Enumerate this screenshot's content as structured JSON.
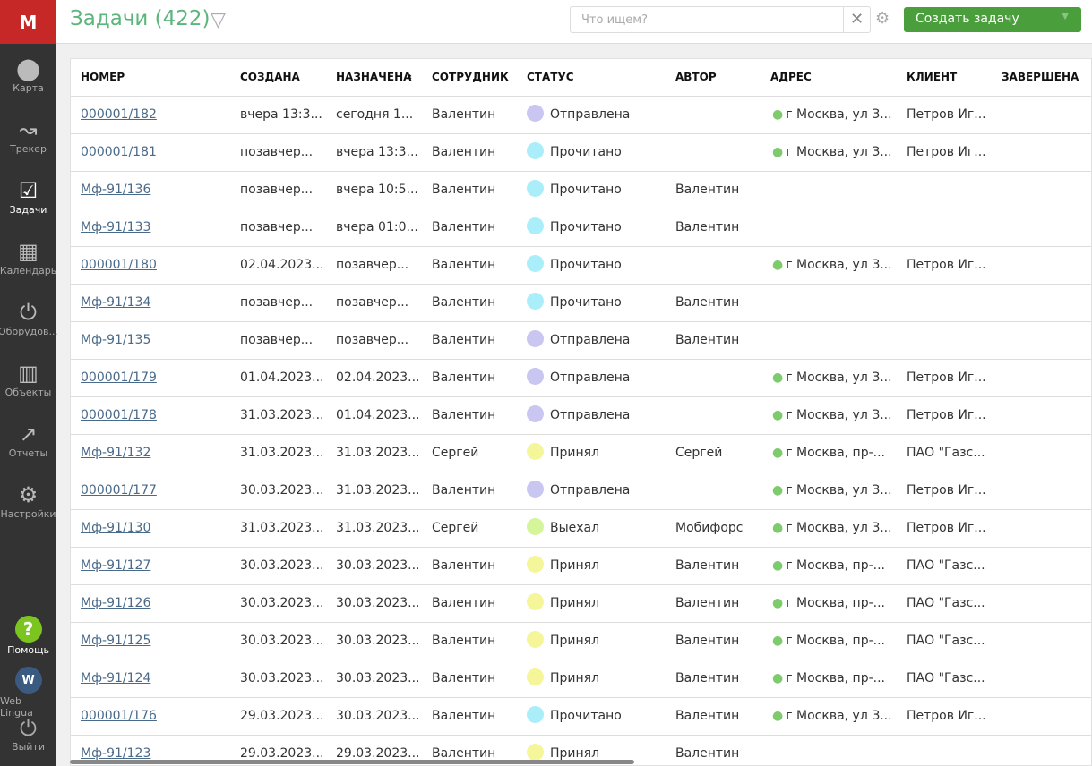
{
  "app": {
    "logo": "M",
    "title": "Задачи (422)"
  },
  "sidebar": {
    "items": [
      {
        "label": "Карта",
        "icon": "map-pin-icon",
        "glyph": "⬤"
      },
      {
        "label": "Трекер",
        "icon": "route-icon",
        "glyph": "↝"
      },
      {
        "label": "Задачи",
        "icon": "clipboard-check-icon",
        "glyph": "☑",
        "active": true
      },
      {
        "label": "Календарь",
        "icon": "calendar-icon",
        "glyph": "▦"
      },
      {
        "label": "Оборудов...",
        "icon": "plug-icon",
        "glyph": "⏻"
      },
      {
        "label": "Объекты",
        "icon": "building-icon",
        "glyph": "▥"
      },
      {
        "label": "Отчеты",
        "icon": "chart-icon",
        "glyph": "↗"
      },
      {
        "label": "Настройки",
        "icon": "gear-icon",
        "glyph": "⚙"
      }
    ],
    "help": "Помощь",
    "lang_label": "Web Lingua",
    "lang_glyph": "W",
    "logout": "Выйти"
  },
  "search": {
    "placeholder": "Что ищем?"
  },
  "create_button": "Создать задачу",
  "columns": [
    "НОМЕР",
    "СОЗДАНА",
    "НАЗНАЧЕНА",
    "СОТРУДНИК",
    "СТАТУС",
    "АВТОР",
    "АДРЕС",
    "КЛИЕНТ",
    "ЗАВЕРШЕНА"
  ],
  "status_colors": {
    "Отправлена": "#c9c6f2",
    "Прочитано": "#aaeefa",
    "Принял": "#f5f59a",
    "Выехал": "#d4f59a"
  },
  "rows": [
    [
      "000001/182",
      "вчера 13:3...",
      "сегодня 1...",
      "Валентин",
      "Отправлена",
      "",
      "г Москва, ул З...",
      "Петров Иг...",
      ""
    ],
    [
      "000001/181",
      "позавчер...",
      "вчера 13:3...",
      "Валентин",
      "Прочитано",
      "",
      "г Москва, ул З...",
      "Петров Иг...",
      ""
    ],
    [
      "Мф-91/136",
      "позавчер...",
      "вчера 10:5...",
      "Валентин",
      "Прочитано",
      "Валентин",
      "",
      "",
      ""
    ],
    [
      "Мф-91/133",
      "позавчер...",
      "вчера 01:0...",
      "Валентин",
      "Прочитано",
      "Валентин",
      "",
      "",
      ""
    ],
    [
      "000001/180",
      "02.04.2023...",
      "позавчер...",
      "Валентин",
      "Прочитано",
      "",
      "г Москва, ул З...",
      "Петров Иг...",
      ""
    ],
    [
      "Мф-91/134",
      "позавчер...",
      "позавчер...",
      "Валентин",
      "Прочитано",
      "Валентин",
      "",
      "",
      ""
    ],
    [
      "Мф-91/135",
      "позавчер...",
      "позавчер...",
      "Валентин",
      "Отправлена",
      "Валентин",
      "",
      "",
      ""
    ],
    [
      "000001/179",
      "01.04.2023...",
      "02.04.2023...",
      "Валентин",
      "Отправлена",
      "",
      "г Москва, ул З...",
      "Петров Иг...",
      ""
    ],
    [
      "000001/178",
      "31.03.2023...",
      "01.04.2023...",
      "Валентин",
      "Отправлена",
      "",
      "г Москва, ул З...",
      "Петров Иг...",
      ""
    ],
    [
      "Мф-91/132",
      "31.03.2023...",
      "31.03.2023...",
      "Сергей",
      "Принял",
      "Сергей",
      "г Москва, пр-...",
      "ПАО \"Газс...",
      ""
    ],
    [
      "000001/177",
      "30.03.2023...",
      "31.03.2023...",
      "Валентин",
      "Отправлена",
      "",
      "г Москва, ул З...",
      "Петров Иг...",
      ""
    ],
    [
      "Мф-91/130",
      "31.03.2023...",
      "31.03.2023...",
      "Сергей",
      "Выехал",
      "Мобифорс",
      "г Москва, ул З...",
      "Петров Иг...",
      ""
    ],
    [
      "Мф-91/127",
      "30.03.2023...",
      "30.03.2023...",
      "Валентин",
      "Принял",
      "Валентин",
      "г Москва, пр-...",
      "ПАО \"Газс...",
      ""
    ],
    [
      "Мф-91/126",
      "30.03.2023...",
      "30.03.2023...",
      "Валентин",
      "Принял",
      "Валентин",
      "г Москва, пр-...",
      "ПАО \"Газс...",
      ""
    ],
    [
      "Мф-91/125",
      "30.03.2023...",
      "30.03.2023...",
      "Валентин",
      "Принял",
      "Валентин",
      "г Москва, пр-...",
      "ПАО \"Газс...",
      ""
    ],
    [
      "Мф-91/124",
      "30.03.2023...",
      "30.03.2023...",
      "Валентин",
      "Принял",
      "Валентин",
      "г Москва, пр-...",
      "ПАО \"Газс...",
      ""
    ],
    [
      "000001/176",
      "29.03.2023...",
      "30.03.2023...",
      "Валентин",
      "Прочитано",
      "Валентин",
      "г Москва, ул З...",
      "Петров Иг...",
      ""
    ],
    [
      "Мф-91/123",
      "29.03.2023...",
      "29.03.2023...",
      "Валентин",
      "Принял",
      "Валентин",
      "",
      "",
      ""
    ]
  ]
}
